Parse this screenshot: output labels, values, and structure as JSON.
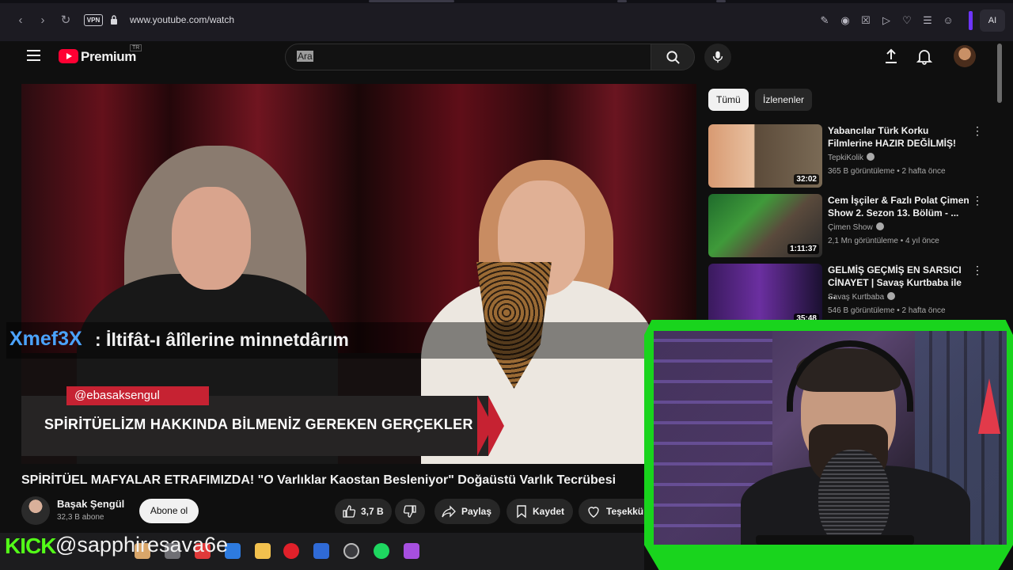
{
  "browser": {
    "url": "www.youtube.com/watch",
    "vpn_label": "VPN",
    "ai_label": "AI"
  },
  "header": {
    "logo_text": "Premium",
    "country_code": "TR",
    "search_placeholder": "Ara"
  },
  "video": {
    "title": "SPİRİTÜEL MAFYALAR ETRAFIMIZDA! \"O Varlıklar Kaostan Besleniyor\" Doğaüstü Varlık Tecrübesi",
    "lower_third_handle": "@ebasaksengul",
    "lower_third_text": "SPİRİTÜELİZM HAKKINDA BİLMENİZ GEREKEN GERÇEKLER",
    "channel_name": "Başak Şengül",
    "subscribers": "32,3 B abone",
    "subscribe_label": "Abone ol",
    "likes": "3,7 B",
    "share_label": "Paylaş",
    "save_label": "Kaydet",
    "thanks_label": "Teşekkü"
  },
  "chat_overlay": {
    "user": "Xmef3X",
    "message": ": İltifât-ı âlîlerine minnetdârım"
  },
  "sidebar": {
    "chips": [
      "Tümü",
      "İzlenenler"
    ],
    "recommendations": [
      {
        "title": "Yabancılar Türk Korku Filmlerine HAZIR DEĞİLMİŞ!",
        "channel": "TepkiKolik",
        "meta": "365 B görüntüleme • 2 hafta önce",
        "duration": "32:02"
      },
      {
        "title": "Cem İşçiler & Fazlı Polat Çimen Show 2. Sezon 13. Bölüm - ...",
        "channel": "Çimen Show",
        "meta": "2,1 Mn görüntüleme • 4 yıl önce",
        "duration": "1:11:37"
      },
      {
        "title": "GELMİŞ GEÇMİŞ EN SARSICI CİNAYET | Savaş Kurtbaba ile ...",
        "channel": "Savaş Kurtbaba",
        "meta": "546 B görüntüleme • 2 hafta önce",
        "duration": "35:48"
      }
    ]
  },
  "stream_overlay": {
    "platform": "KICK",
    "handle": "@sapphiresava6e"
  },
  "colors": {
    "accent_red": "#ff0033",
    "kick_green": "#53fc18",
    "frame_green": "#19d41d",
    "chat_user_blue": "#4ba3ff"
  }
}
